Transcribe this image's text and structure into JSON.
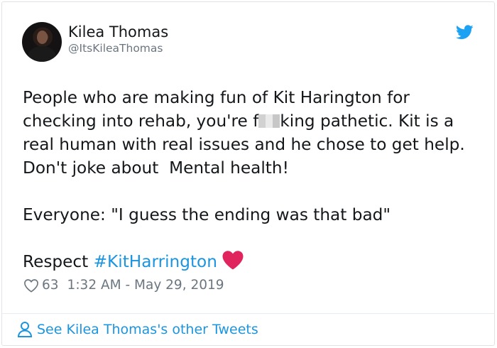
{
  "tweet": {
    "author_name": "Kilea Thomas",
    "author_handle": "@ItsKileaThomas",
    "body_before_redaction": "People who are making fun of Kit Harington for checking into rehab, you're f",
    "body_after_redaction": "king pathetic. Kit is a real human with real issues and he chose to get help. Don't joke about  Mental health!\n\nEveryone: \"I guess the ending was that bad\"\n\nRespect ",
    "hashtag": "#KitHarrington",
    "like_count": "63",
    "timestamp": "1:32 AM - May 29, 2019"
  },
  "footer": {
    "link_text": "See Kilea Thomas's other Tweets"
  },
  "icons": {
    "brand": "twitter-bird-icon",
    "emoji": "red-heart-icon",
    "like": "heart-outline-icon",
    "profile": "person-icon"
  },
  "colors": {
    "link": "#1b95e0",
    "text": "#14171a",
    "muted": "#6b7680",
    "heart": "#e0245e"
  }
}
